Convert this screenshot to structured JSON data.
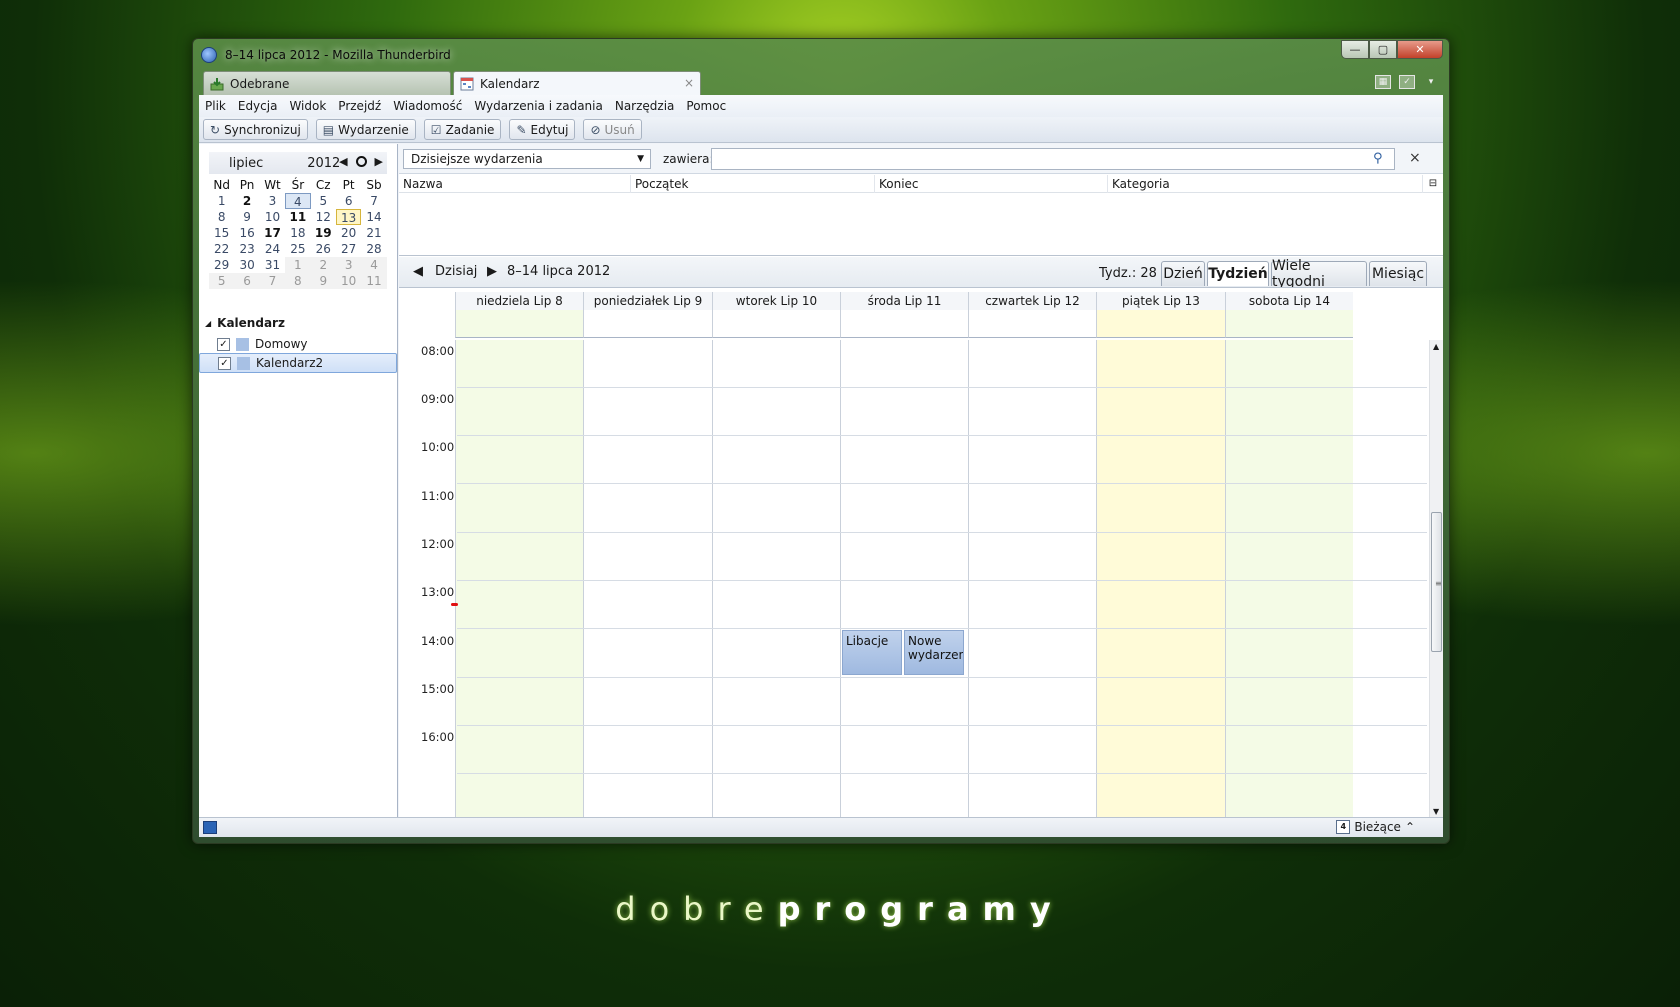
{
  "window": {
    "title": "8–14 lipca 2012 - Mozilla Thunderbird",
    "minimize": "—",
    "maximize": "▢",
    "close": "✕"
  },
  "tabs": [
    {
      "label": "Odebrane",
      "active": false
    },
    {
      "label": "Kalendarz",
      "active": true,
      "close": "×"
    }
  ],
  "menu": [
    "Plik",
    "Edycja",
    "Widok",
    "Przejdź",
    "Wiadomość",
    "Wydarzenia i zadania",
    "Narzędzia",
    "Pomoc"
  ],
  "toolbar": {
    "sync": "Synchronizuj",
    "event": "Wydarzenie",
    "task": "Zadanie",
    "edit": "Edytuj",
    "delete": "Usuń"
  },
  "minimonth": {
    "month": "lipiec",
    "year": "2012",
    "weekdays": [
      "Nd",
      "Pn",
      "Wt",
      "Śr",
      "Cz",
      "Pt",
      "Sb"
    ],
    "days": [
      [
        "1",
        "2",
        "3",
        "4",
        "5",
        "6",
        "7"
      ],
      [
        "8",
        "9",
        "10",
        "11",
        "12",
        "13",
        "14"
      ],
      [
        "15",
        "16",
        "17",
        "18",
        "19",
        "20",
        "21"
      ],
      [
        "22",
        "23",
        "24",
        "25",
        "26",
        "27",
        "28"
      ],
      [
        "29",
        "30",
        "31",
        "1",
        "2",
        "3",
        "4"
      ],
      [
        "5",
        "6",
        "7",
        "8",
        "9",
        "10",
        "11"
      ]
    ]
  },
  "calendars": {
    "header": "Kalendarz",
    "items": [
      {
        "name": "Domowy",
        "checked": "✓"
      },
      {
        "name": "Kalendarz2",
        "checked": "✓"
      }
    ]
  },
  "filter": {
    "select": "Dzisiejsze wydarzenia",
    "contains_label": "zawiera:",
    "search_value": ""
  },
  "event_list_columns": [
    "Nazwa",
    "Początek",
    "Koniec",
    "Kategoria"
  ],
  "navigation": {
    "today": "Dzisiaj",
    "range": "8–14 lipca 2012",
    "week": "Tydz.: 28",
    "views": [
      "Dzień",
      "Tydzień",
      "Wiele tygodni",
      "Miesiąc"
    ],
    "active_view": "Tydzień"
  },
  "week": {
    "days": [
      "niedziela Lip 8",
      "poniedziałek Lip 9",
      "wtorek Lip 10",
      "środa Lip 11",
      "czwartek Lip 12",
      "piątek Lip 13",
      "sobota Lip 14"
    ],
    "hours": [
      "08:00",
      "09:00",
      "10:00",
      "11:00",
      "12:00",
      "13:00",
      "14:00",
      "15:00",
      "16:00"
    ],
    "events": [
      {
        "title": "Libacje",
        "day": 3,
        "start": "14:00",
        "end": "15:00"
      },
      {
        "title": "Nowe wydarzenie",
        "day": 3,
        "start": "14:00",
        "end": "15:00"
      }
    ]
  },
  "statusbar": {
    "today_view": "Bieżące",
    "cal_icon_num": "4"
  },
  "watermark": {
    "part1": "dobre",
    "part2": "programy"
  },
  "colors": {
    "weekend": "#f4fbe6",
    "today": "#fffbd8",
    "event": "#a9c1e6"
  }
}
